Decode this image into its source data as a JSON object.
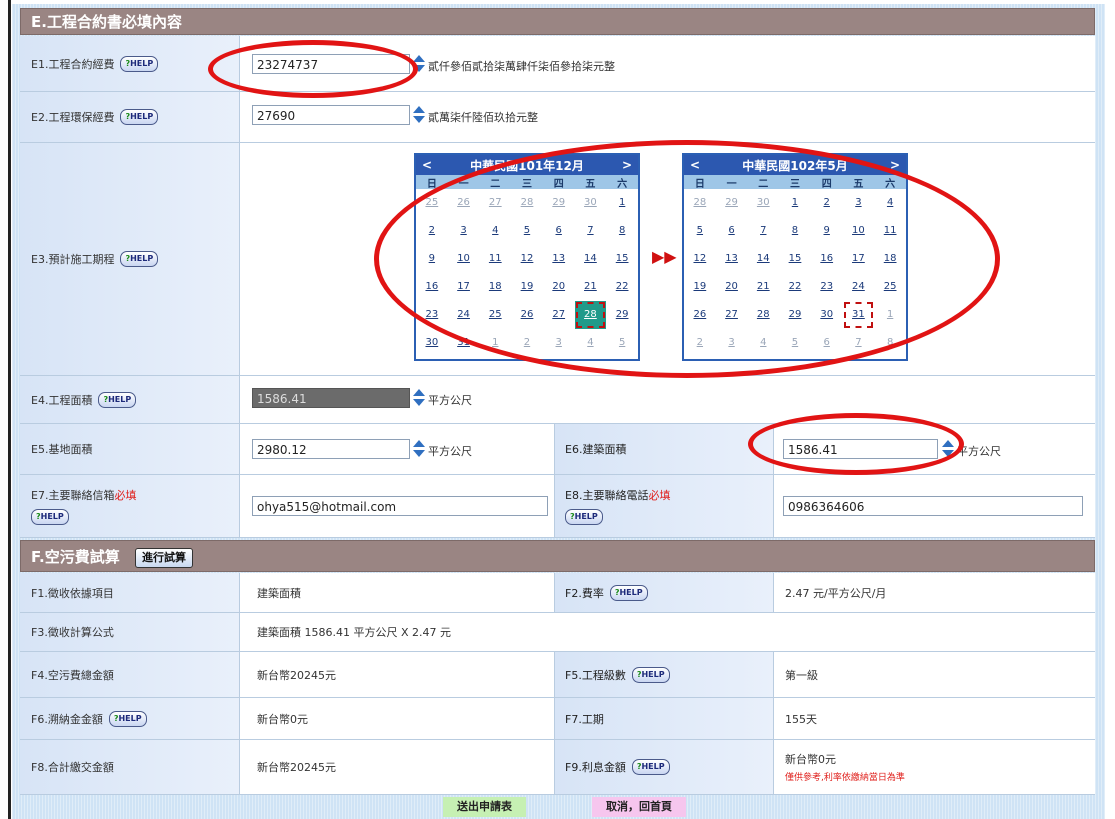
{
  "section_e": {
    "title": "E.工程合約書必填內容"
  },
  "help_label": "HELP",
  "e1": {
    "label": "E1.工程合約經費",
    "value": "23274737",
    "words": "貳仟參佰貳拾柒萬肆仟柒佰參拾柒元整"
  },
  "e2": {
    "label": "E2.工程環保經費",
    "value": "27690",
    "words": "貳萬柒仟陸佰玖拾元整"
  },
  "e3": {
    "label": "E3.預計施工期程",
    "weekdays": [
      "日",
      "一",
      "二",
      "三",
      "四",
      "五",
      "六"
    ],
    "cal1": {
      "title": "中華民國101年12月",
      "days": [
        "25",
        "26",
        "27",
        "28",
        "29",
        "30",
        "1",
        "2",
        "3",
        "4",
        "5",
        "6",
        "7",
        "8",
        "9",
        "10",
        "11",
        "12",
        "13",
        "14",
        "15",
        "16",
        "17",
        "18",
        "19",
        "20",
        "21",
        "22",
        "23",
        "24",
        "25",
        "26",
        "27",
        "28",
        "29",
        "30",
        "31",
        "1",
        "2",
        "3",
        "4",
        "5"
      ],
      "selected": "28"
    },
    "cal2": {
      "title": "中華民國102年5月",
      "days": [
        "28",
        "29",
        "30",
        "1",
        "2",
        "3",
        "4",
        "5",
        "6",
        "7",
        "8",
        "9",
        "10",
        "11",
        "12",
        "13",
        "14",
        "15",
        "16",
        "17",
        "18",
        "19",
        "20",
        "21",
        "22",
        "23",
        "24",
        "25",
        "26",
        "27",
        "28",
        "29",
        "30",
        "31",
        "1",
        "2",
        "3",
        "4",
        "5",
        "6",
        "7",
        "8"
      ],
      "selected": "31"
    },
    "prev": "<",
    "next": ">",
    "between": "▶▶"
  },
  "e4": {
    "label": "E4.工程面積",
    "value": "1586.41",
    "unit": "平方公尺"
  },
  "e5": {
    "label": "E5.基地面積",
    "value": "2980.12",
    "unit": "平方公尺"
  },
  "e6": {
    "label": "E6.建築面積",
    "value": "1586.41",
    "unit": "平方公尺"
  },
  "e7": {
    "label": "E7.主要聯絡信箱",
    "required": "必填",
    "value": "ohya515@hotmail.com"
  },
  "e8": {
    "label": "E8.主要聯絡電話",
    "required": "必填",
    "value": "0986364606"
  },
  "section_f": {
    "title": "F.空污費試算",
    "calc_button": "進行試算"
  },
  "f1": {
    "label": "F1.徵收依據項目",
    "value": "建築面積"
  },
  "f2": {
    "label": "F2.費率",
    "value": "2.47 元/平方公尺/月"
  },
  "f3": {
    "label": "F3.徵收計算公式",
    "value": "建築面積 1586.41 平方公尺 X 2.47 元"
  },
  "f4": {
    "label": "F4.空污費總金額",
    "value": "新台幣20245元"
  },
  "f5": {
    "label": "F5.工程級數",
    "value": "第一級"
  },
  "f6": {
    "label": "F6.溯納金金額",
    "value": "新台幣0元"
  },
  "f7": {
    "label": "F7.工期",
    "value": "155天"
  },
  "f8": {
    "label": "F8.合計繳交金額",
    "value": "新台幣20245元"
  },
  "f9": {
    "label": "F9.利息金額",
    "value": "新台幣0元",
    "note": "僅供參考,利率依繳納當日為準"
  },
  "footer": {
    "submit": "送出申請表",
    "cancel": "取消，回首頁"
  },
  "colors": {
    "header_bg": "#9a8583",
    "calendar_header": "#2c58b0",
    "selected_day": "#1f9a8a",
    "annotation": "#e11414"
  }
}
